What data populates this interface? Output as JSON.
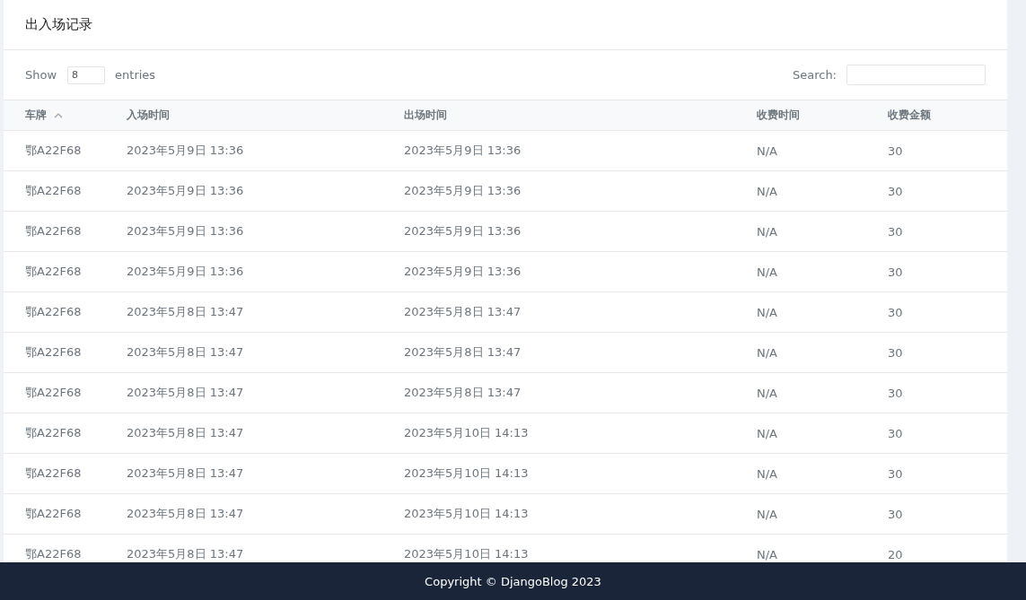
{
  "card": {
    "title": "出入场记录"
  },
  "length_control": {
    "label_before": "Show",
    "value": "8",
    "label_after": "entries"
  },
  "search": {
    "label": "Search:"
  },
  "table": {
    "columns": [
      {
        "label": "车牌",
        "sorted": true
      },
      {
        "label": "入场时间",
        "sorted": false
      },
      {
        "label": "出场时间",
        "sorted": false
      },
      {
        "label": "收费时间",
        "sorted": false
      },
      {
        "label": "收费金额",
        "sorted": false
      }
    ],
    "rows": [
      [
        "鄂A22F68",
        "2023年5月9日 13:36",
        "2023年5月9日 13:36",
        "N/A",
        "30"
      ],
      [
        "鄂A22F68",
        "2023年5月9日 13:36",
        "2023年5月9日 13:36",
        "N/A",
        "30"
      ],
      [
        "鄂A22F68",
        "2023年5月9日 13:36",
        "2023年5月9日 13:36",
        "N/A",
        "30"
      ],
      [
        "鄂A22F68",
        "2023年5月9日 13:36",
        "2023年5月9日 13:36",
        "N/A",
        "30"
      ],
      [
        "鄂A22F68",
        "2023年5月8日 13:47",
        "2023年5月8日 13:47",
        "N/A",
        "30"
      ],
      [
        "鄂A22F68",
        "2023年5月8日 13:47",
        "2023年5月8日 13:47",
        "N/A",
        "30"
      ],
      [
        "鄂A22F68",
        "2023年5月8日 13:47",
        "2023年5月8日 13:47",
        "N/A",
        "30"
      ],
      [
        "鄂A22F68",
        "2023年5月8日 13:47",
        "2023年5月10日 14:13",
        "N/A",
        "30"
      ],
      [
        "鄂A22F68",
        "2023年5月8日 13:47",
        "2023年5月10日 14:13",
        "N/A",
        "30"
      ],
      [
        "鄂A22F68",
        "2023年5月8日 13:47",
        "2023年5月10日 14:13",
        "N/A",
        "30"
      ],
      [
        "鄂A22F68",
        "2023年5月8日 13:47",
        "2023年5月10日 14:13",
        "N/A",
        "20"
      ]
    ]
  },
  "footer": {
    "text": "Copyright © DjangoBlog 2023"
  }
}
